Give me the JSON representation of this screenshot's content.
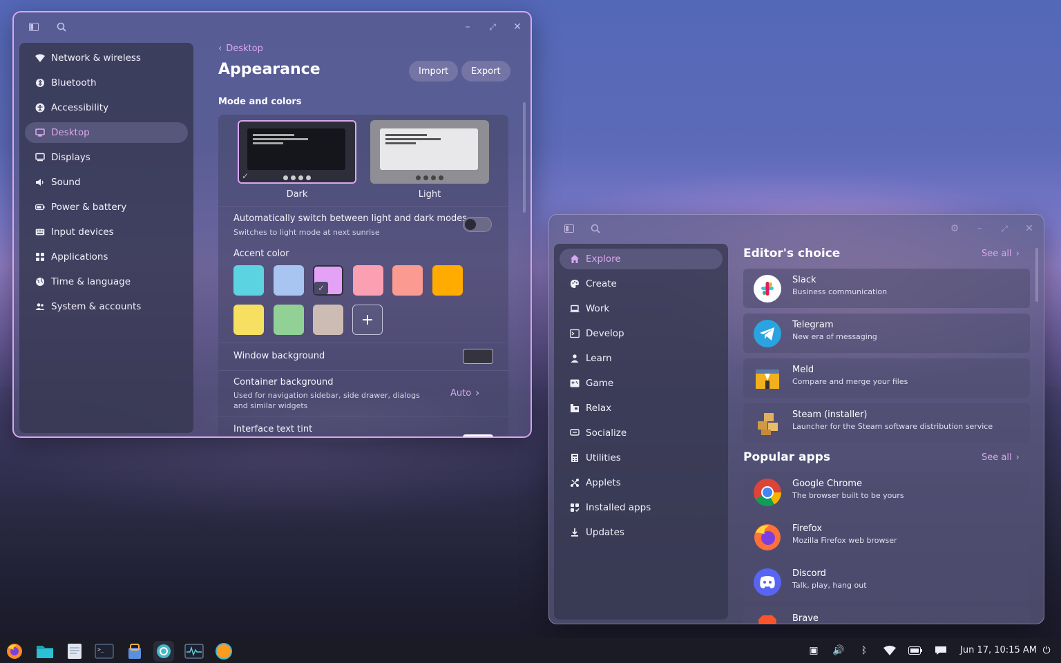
{
  "settings": {
    "nav": [
      {
        "label": "Network & wireless",
        "icon": "wifi-icon"
      },
      {
        "label": "Bluetooth",
        "icon": "bluetooth-icon"
      },
      {
        "label": "Accessibility",
        "icon": "accessibility-icon"
      },
      {
        "label": "Desktop",
        "icon": "monitor-icon",
        "active": true
      },
      {
        "label": "Displays",
        "icon": "displays-icon"
      },
      {
        "label": "Sound",
        "icon": "speaker-icon"
      },
      {
        "label": "Power & battery",
        "icon": "battery-icon"
      },
      {
        "label": "Input devices",
        "icon": "keyboard-icon"
      },
      {
        "label": "Applications",
        "icon": "apps-grid-icon"
      },
      {
        "label": "Time & language",
        "icon": "globe-icon"
      },
      {
        "label": "System & accounts",
        "icon": "users-icon"
      }
    ],
    "breadcrumb": "Desktop",
    "title": "Appearance",
    "import_label": "Import",
    "export_label": "Export",
    "section_title": "Mode and colors",
    "themes": {
      "dark": "Dark",
      "light": "Light"
    },
    "auto_switch": {
      "title": "Automatically switch between light and dark modes",
      "subtitle": "Switches to light mode at next sunrise",
      "enabled": false
    },
    "accent_title": "Accent color",
    "accent_colors": [
      "#5bd3e0",
      "#a8c4f0",
      "#e3a2f5",
      "#fb9fb2",
      "#fa9a91",
      "#ffab00",
      "#f7df61",
      "#91d196",
      "#cdbcb3"
    ],
    "accent_selected_index": 2,
    "window_background": "Window background",
    "container_background": {
      "title": "Container background",
      "subtitle": "Used for navigation sidebar, side drawer, dialogs and similar widgets",
      "value": "Auto"
    },
    "interface_text_tint": "Interface text tint"
  },
  "store": {
    "nav": [
      {
        "label": "Explore",
        "icon": "home-icon",
        "active": true
      },
      {
        "label": "Create",
        "icon": "palette-icon"
      },
      {
        "label": "Work",
        "icon": "laptop-icon"
      },
      {
        "label": "Develop",
        "icon": "terminal-icon"
      },
      {
        "label": "Learn",
        "icon": "learn-icon"
      },
      {
        "label": "Game",
        "icon": "gamepad-icon"
      },
      {
        "label": "Relax",
        "icon": "relax-icon"
      },
      {
        "label": "Socialize",
        "icon": "chat-icon"
      },
      {
        "label": "Utilities",
        "icon": "utilities-icon"
      },
      {
        "label": "Applets",
        "icon": "applets-icon"
      },
      {
        "label": "Installed apps",
        "icon": "installed-icon"
      },
      {
        "label": "Updates",
        "icon": "download-icon"
      }
    ],
    "editors_choice_title": "Editor's choice",
    "popular_title": "Popular apps",
    "see_all": "See all",
    "editors_choice": [
      {
        "name": "Slack",
        "desc": "Business communication"
      },
      {
        "name": "Telegram",
        "desc": "New era of messaging"
      },
      {
        "name": "Meld",
        "desc": "Compare and merge your files"
      },
      {
        "name": "Steam (installer)",
        "desc": "Launcher for the Steam software distribution service"
      }
    ],
    "popular": [
      {
        "name": "Google Chrome",
        "desc": "The browser built to be yours"
      },
      {
        "name": "Firefox",
        "desc": "Mozilla Firefox web browser"
      },
      {
        "name": "Discord",
        "desc": "Talk, play, hang out"
      },
      {
        "name": "Brave",
        "desc": ""
      }
    ]
  },
  "taskbar": {
    "clock": "Jun 17, 10:15 AM"
  }
}
